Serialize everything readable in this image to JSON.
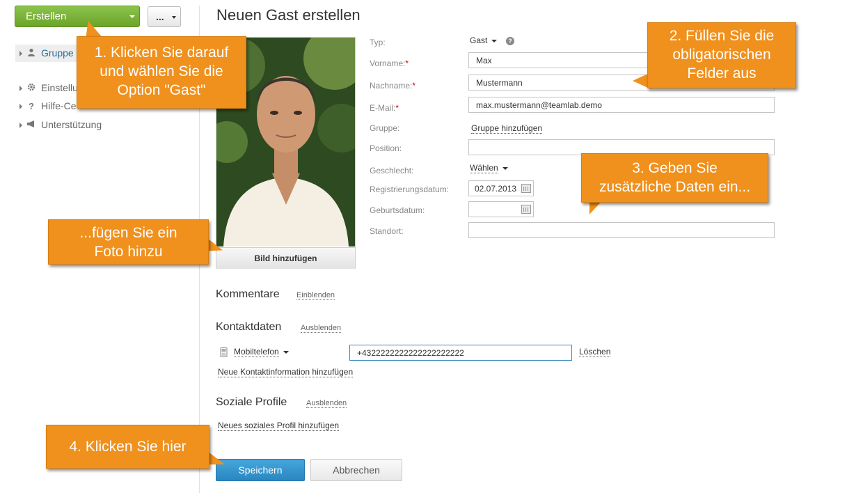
{
  "toolbar": {
    "create_label": "Erstellen",
    "more_label": "..."
  },
  "sidebar": {
    "items": [
      {
        "label": "Gruppe",
        "icon": "user-icon"
      },
      {
        "label": "Einstellu",
        "icon": "gear-icon"
      },
      {
        "label": "Hilfe-Ce",
        "icon": "help-icon"
      },
      {
        "label": "Unterstützung",
        "icon": "megaphone-icon"
      }
    ]
  },
  "page": {
    "title": "Neuen Gast erstellen"
  },
  "photo": {
    "add_label": "Bild hinzufügen"
  },
  "form": {
    "type_label": "Typ:",
    "type_value": "Gast",
    "firstname_label": "Vorname:",
    "firstname_value": "Max",
    "lastname_label": "Nachname:",
    "lastname_value": "Mustermann",
    "email_label": "E-Mail:",
    "email_value": "max.mustermann@teamlab.demo",
    "group_label": "Gruppe:",
    "group_link": "Gruppe hinzufügen",
    "position_label": "Position:",
    "position_value": "",
    "gender_label": "Geschlecht:",
    "gender_value": "Wählen",
    "regdate_label": "Registrierungsdatum:",
    "regdate_value": "02.07.2013",
    "birthdate_label": "Geburtsdatum:",
    "birthdate_value": "",
    "location_label": "Standort:",
    "location_value": "",
    "required_mark": "*"
  },
  "comments": {
    "title": "Kommentare",
    "toggle": "Einblenden"
  },
  "contacts": {
    "title": "Kontaktdaten",
    "toggle": "Ausblenden",
    "type_value": "Mobiltelefon",
    "phone_value": "+4322222222222222222222",
    "delete_label": "Löschen",
    "add_link": "Neue Kontaktinformation hinzufügen"
  },
  "social": {
    "title": "Soziale Profile",
    "toggle": "Ausblenden",
    "add_link": "Neues soziales Profil hinzufügen"
  },
  "actions": {
    "save_label": "Speichern",
    "cancel_label": "Abbrechen"
  },
  "callouts": {
    "c1": [
      "1. Klicken Sie darauf",
      "und wählen Sie die",
      "Option \"Gast\""
    ],
    "c2": [
      "2. Füllen Sie die",
      "obligatorischen",
      "Felder aus"
    ],
    "c3": [
      "3. Geben Sie",
      "zusätzliche Daten ein..."
    ],
    "c4": [
      "...fügen Sie ein",
      "Foto hinzu"
    ],
    "c5": [
      "4. Klicken Sie hier"
    ]
  },
  "colors": {
    "callout": "#f0901d",
    "create_button": "#7ab33a",
    "save_button": "#3497d1",
    "accent_link": "#2a6a95"
  }
}
